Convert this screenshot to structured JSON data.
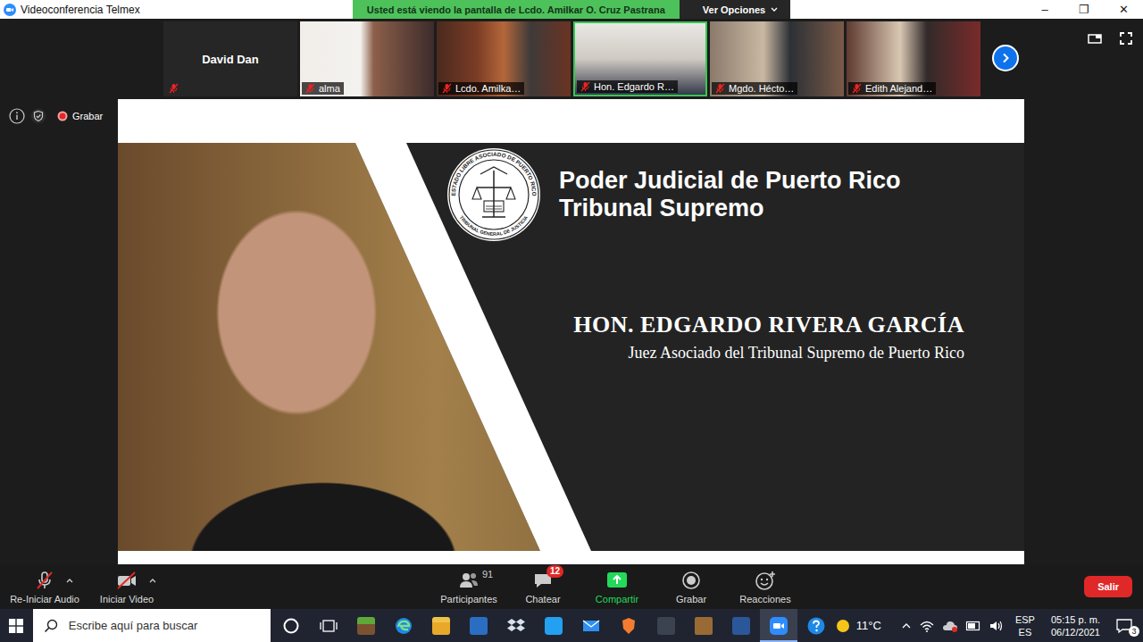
{
  "window": {
    "title": "Videoconferencia Telmex",
    "controls": [
      "–",
      "❐",
      "✕"
    ]
  },
  "banner": {
    "text": "Usted está viendo la pantalla de Lcdo. Amilkar O. Cruz Pastrana",
    "options": "Ver Opciones"
  },
  "tiles": [
    {
      "name": "David Dan",
      "kind": "name",
      "muted": true,
      "speaking": false
    },
    {
      "name": "alma",
      "kind": "video",
      "muted": true,
      "speaking": false
    },
    {
      "name": "Lcdo. Amilka…",
      "kind": "video",
      "muted": true,
      "speaking": false
    },
    {
      "name": "Hon. Edgardo R…",
      "kind": "video",
      "muted": true,
      "speaking": true
    },
    {
      "name": "Mgdo. Hécto…",
      "kind": "video",
      "muted": true,
      "speaking": false
    },
    {
      "name": "Edith Alejand…",
      "kind": "video",
      "muted": true,
      "speaking": false
    }
  ],
  "meeting_info": {
    "recording_label": "Grabar"
  },
  "slide": {
    "seal_top": "ESTADO LIBRE ASOCIADO DE PUERTO RICO",
    "seal_bottom": "TRIBUNAL GENERAL DE JUSTICIA",
    "org": "Poder Judicial de Puerto Rico",
    "court": "Tribunal Supremo",
    "name": "HON. EDGARDO RIVERA GARCÍA",
    "role": "Juez Asociado del Tribunal Supremo de Puerto Rico"
  },
  "toolbar": {
    "left": [
      {
        "label": "Re-Iniciar Audio",
        "kind": "mic",
        "muted": true
      },
      {
        "label": "Iniciar Video",
        "kind": "video",
        "muted": true
      }
    ],
    "center": [
      {
        "label": "Participantes",
        "kind": "participants",
        "count": "91",
        "badge": ""
      },
      {
        "label": "Chatear",
        "kind": "chat",
        "count": "",
        "badge": "12"
      },
      {
        "label": "Compartir",
        "kind": "share",
        "count": "",
        "badge": ""
      },
      {
        "label": "Grabar",
        "kind": "record",
        "count": "",
        "badge": ""
      },
      {
        "label": "Reacciones",
        "kind": "reactions",
        "count": "",
        "badge": ""
      }
    ],
    "leave": "Salir"
  },
  "taskbar": {
    "search": "Escribe aquí para buscar",
    "apps": [
      {
        "kind": "cortana",
        "active": false
      },
      {
        "kind": "taskview",
        "active": false
      },
      {
        "kind": "minecraft",
        "active": false
      },
      {
        "kind": "edge",
        "active": false
      },
      {
        "kind": "explorer",
        "active": false
      },
      {
        "kind": "store",
        "active": false
      },
      {
        "kind": "dropbox",
        "active": false
      },
      {
        "kind": "vscode",
        "active": false
      },
      {
        "kind": "mail",
        "active": false
      },
      {
        "kind": "brave",
        "active": false
      },
      {
        "kind": "terminal",
        "active": false
      },
      {
        "kind": "chest",
        "active": false
      },
      {
        "kind": "word",
        "active": false
      },
      {
        "kind": "zoom",
        "active": true
      },
      {
        "kind": "help",
        "active": false
      }
    ],
    "weather": "11°C",
    "lang": [
      "ESP",
      "ES"
    ],
    "time": "05:15 p. m.",
    "date": "06/12/2021",
    "notifications": "3"
  }
}
